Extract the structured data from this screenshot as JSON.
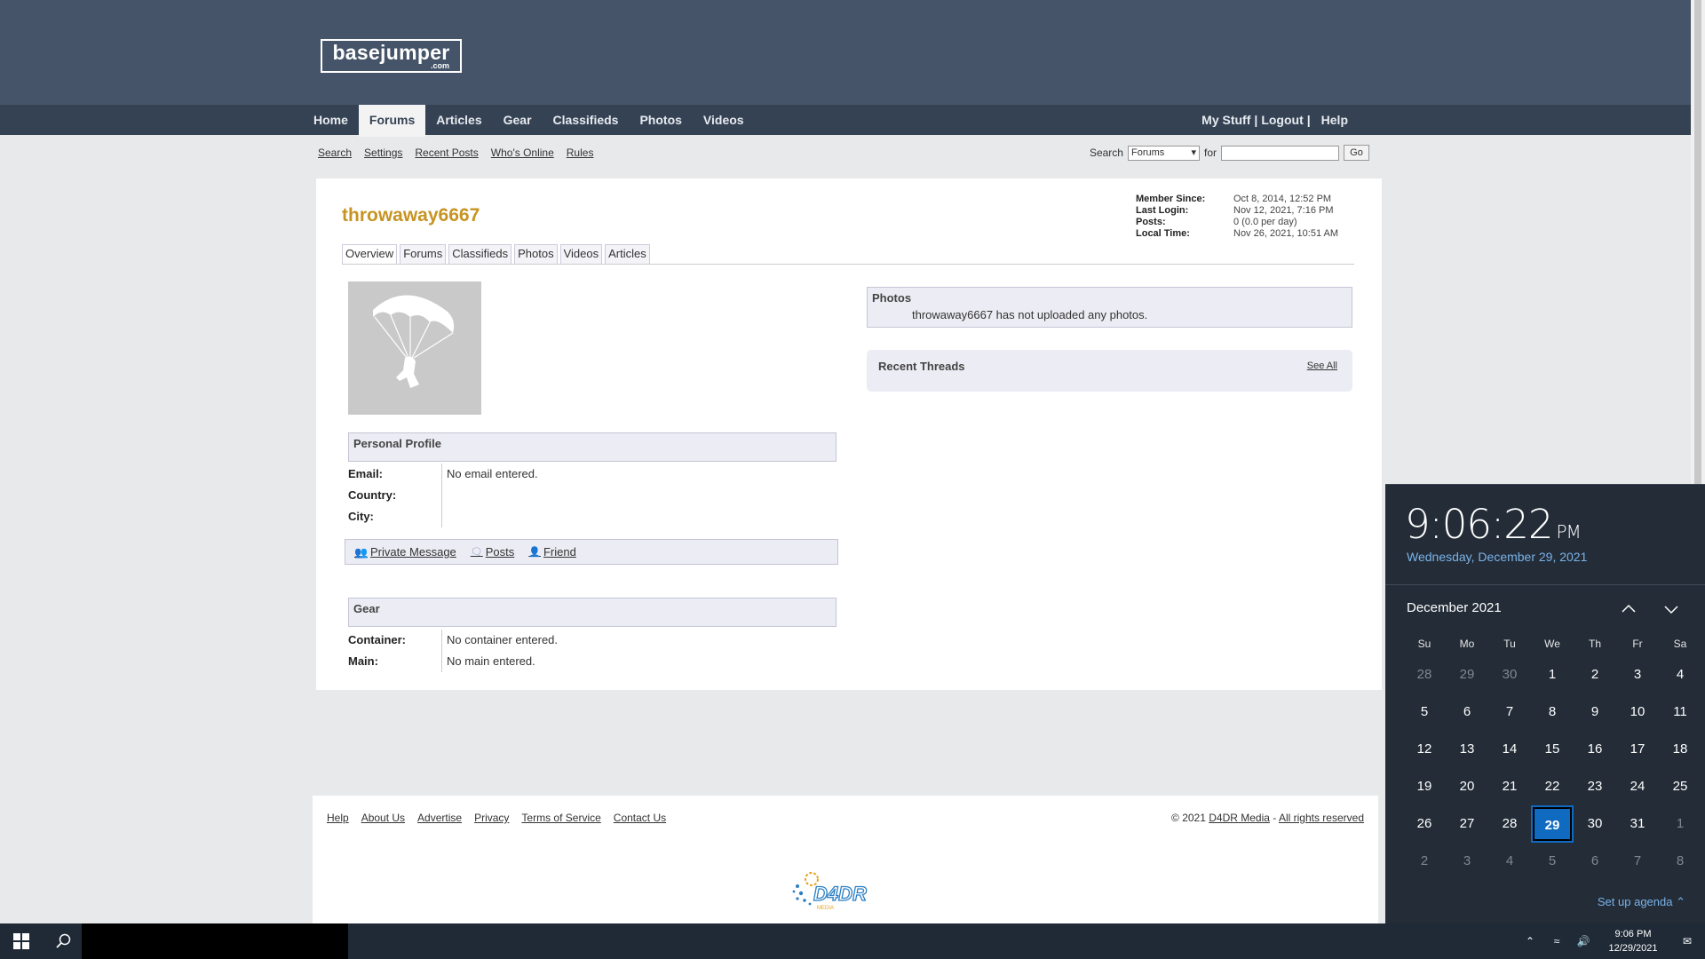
{
  "site": {
    "logo_main": "basejumper",
    "logo_sub": ".com"
  },
  "nav": {
    "items": [
      "Home",
      "Forums",
      "Articles",
      "Gear",
      "Classifieds",
      "Photos",
      "Videos"
    ],
    "active": "Forums",
    "right": {
      "my_stuff": "My Stuff",
      "logout": "Logout",
      "help": "Help",
      "sep": "|"
    }
  },
  "subnav": [
    "Search",
    "Settings",
    "Recent Posts",
    "Who's Online",
    "Rules"
  ],
  "search": {
    "label": "Search",
    "select_value": "Forums",
    "for_label": "for",
    "go": "Go"
  },
  "profile": {
    "username": "throwaway6667",
    "member_info": [
      {
        "k": "Member Since:",
        "v": "Oct 8, 2014, 12:52 PM"
      },
      {
        "k": "Last Login:",
        "v": "Nov 12, 2021, 7:16 PM"
      },
      {
        "k": "Posts:",
        "v": "0 (0.0 per day)"
      },
      {
        "k": "Local Time:",
        "v": "Nov 26, 2021, 10:51 AM"
      }
    ],
    "tabs": [
      "Overview",
      "Forums",
      "Classifieds",
      "Photos",
      "Videos",
      "Articles"
    ],
    "personal_title": "Personal Profile",
    "personal": [
      {
        "k": "Email:",
        "v": "No email entered."
      },
      {
        "k": "Country:",
        "v": ""
      },
      {
        "k": "City:",
        "v": ""
      }
    ],
    "actions": {
      "pm": "Private Message",
      "posts": "Posts",
      "friend": "Friend"
    },
    "gear_title": "Gear",
    "gear": [
      {
        "k": "Container:",
        "v": "No container entered."
      },
      {
        "k": "Main:",
        "v": "No main entered."
      }
    ],
    "photos_title": "Photos",
    "photos_msg": "throwaway6667 has not uploaded any photos.",
    "threads_title": "Recent Threads",
    "see_all": "See All"
  },
  "footer": {
    "links": [
      "Help",
      "About Us",
      "Advertise",
      "Privacy",
      "Terms of Service",
      "Contact Us"
    ],
    "copyright_prefix": "© 2021",
    "company": "D4DR Media",
    "dash": "-",
    "rights": "All rights reserved",
    "logo_text": "D4DR",
    "logo_sub": "MEDIA"
  },
  "flyout": {
    "time": "9:06:22",
    "ampm": "PM",
    "date": "Wednesday, December 29, 2021",
    "month": "December 2021",
    "dow": [
      "Su",
      "Mo",
      "Tu",
      "We",
      "Th",
      "Fr",
      "Sa"
    ],
    "days": [
      {
        "d": "28",
        "m": true
      },
      {
        "d": "29",
        "m": true
      },
      {
        "d": "30",
        "m": true
      },
      {
        "d": "1"
      },
      {
        "d": "2"
      },
      {
        "d": "3"
      },
      {
        "d": "4"
      },
      {
        "d": "5"
      },
      {
        "d": "6"
      },
      {
        "d": "7"
      },
      {
        "d": "8"
      },
      {
        "d": "9"
      },
      {
        "d": "10"
      },
      {
        "d": "11"
      },
      {
        "d": "12"
      },
      {
        "d": "13"
      },
      {
        "d": "14"
      },
      {
        "d": "15"
      },
      {
        "d": "16"
      },
      {
        "d": "17"
      },
      {
        "d": "18"
      },
      {
        "d": "19"
      },
      {
        "d": "20"
      },
      {
        "d": "21"
      },
      {
        "d": "22"
      },
      {
        "d": "23"
      },
      {
        "d": "24"
      },
      {
        "d": "25"
      },
      {
        "d": "26"
      },
      {
        "d": "27"
      },
      {
        "d": "28"
      },
      {
        "d": "29",
        "t": true
      },
      {
        "d": "30"
      },
      {
        "d": "31"
      },
      {
        "d": "1",
        "m": true
      },
      {
        "d": "2",
        "m": true
      },
      {
        "d": "3",
        "m": true
      },
      {
        "d": "4",
        "m": true
      },
      {
        "d": "5",
        "m": true
      },
      {
        "d": "6",
        "m": true
      },
      {
        "d": "7",
        "m": true
      },
      {
        "d": "8",
        "m": true
      }
    ],
    "agenda": "Set up agenda"
  },
  "taskbar": {
    "time": "9:06 PM",
    "date": "12/29/2021"
  },
  "colors": {
    "header": "#455468",
    "nav": "#354254",
    "username": "#c79422",
    "today": "#0f6ac0",
    "flyout": "#232c37"
  }
}
